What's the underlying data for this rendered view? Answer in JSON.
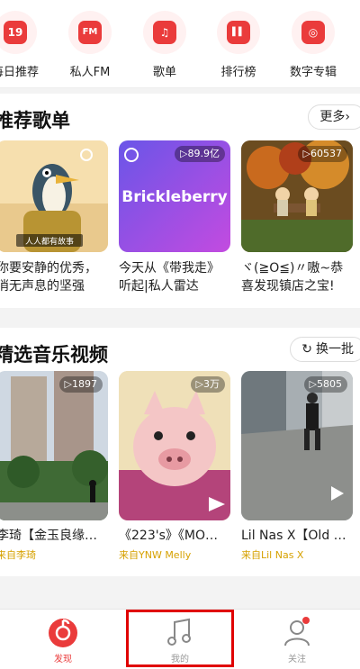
{
  "quick_nav": [
    {
      "label": "每日推荐",
      "icon": "calendar-icon",
      "glyph": "19"
    },
    {
      "label": "私人FM",
      "icon": "radio-icon",
      "glyph": "FM"
    },
    {
      "label": "歌单",
      "icon": "playlist-icon",
      "glyph": "♫"
    },
    {
      "label": "排行榜",
      "icon": "chart-icon",
      "glyph": "▌▌"
    },
    {
      "label": "数字专辑",
      "icon": "album-icon",
      "glyph": "◎"
    }
  ],
  "recommended": {
    "title": "推荐歌单",
    "more_label": "更多",
    "more_icon": "chevron-right-icon",
    "items": [
      {
        "title": "你要安静的优秀，消无声息的坚强",
        "play_count": "",
        "caption": "人人都有故事"
      },
      {
        "title": "今天从《带我走》听起|私人雷达",
        "play_count": "89.9亿",
        "caption": "Brickleberry"
      },
      {
        "title": "ヾ(≧O≦)〃嗷~恭喜发现镇店之宝!",
        "play_count": "60537",
        "caption": ""
      }
    ]
  },
  "videos": {
    "title": "精选音乐视频",
    "refresh_label": "换一批",
    "refresh_icon": "refresh-icon",
    "items": [
      {
        "title": "李琦【金玉良缘…",
        "play_count": "1897",
        "source": "来自李琦"
      },
      {
        "title": "《223's》《MO…",
        "play_count": "3万",
        "source": "来自YNW Melly"
      },
      {
        "title": "Lil Nas X【Old …",
        "play_count": "5805",
        "source": "来自Lil Nas X"
      }
    ]
  },
  "tabbar": {
    "tabs": [
      {
        "label": "发现",
        "icon": "discover-icon",
        "active": true
      },
      {
        "label": "我的",
        "icon": "music-note-icon",
        "active": false
      },
      {
        "label": "关注",
        "icon": "user-icon",
        "active": false
      }
    ]
  },
  "colors": {
    "accent": "#ea3b3b",
    "highlight": "#e00000",
    "source_text": "#d6a100"
  }
}
